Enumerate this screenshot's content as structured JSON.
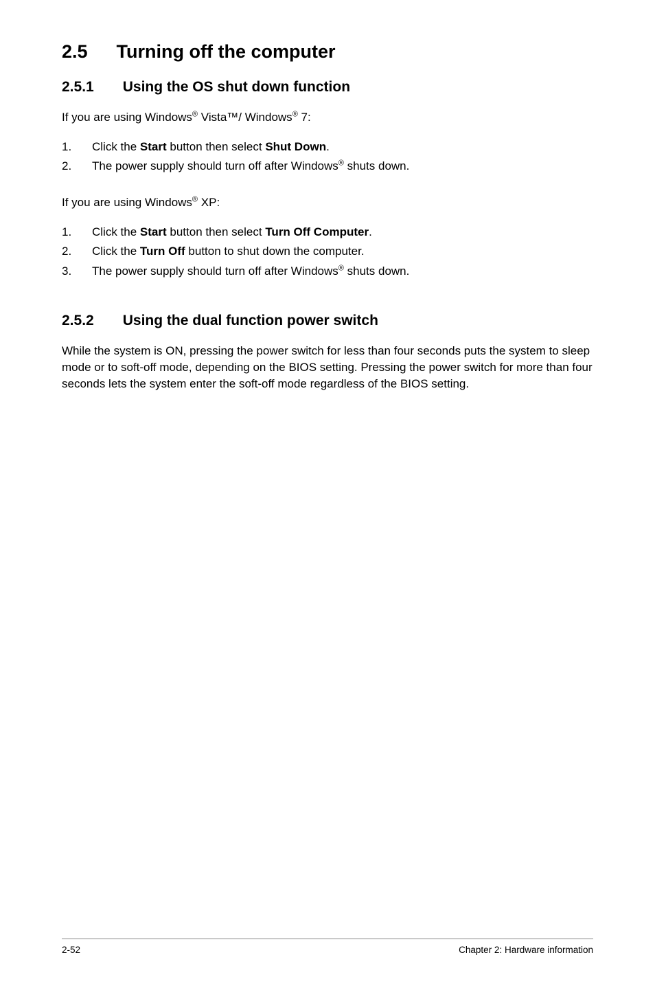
{
  "section": {
    "number": "2.5",
    "title": "Turning off the computer"
  },
  "subsection1": {
    "number": "2.5.1",
    "title": "Using the OS shut down function",
    "intro1_prefix": "If you are using Windows",
    "intro1_mid": " Vista™/ Windows",
    "intro1_suffix": " 7:",
    "list1": [
      {
        "num": "1.",
        "pre": "Click the ",
        "bold1": "Start",
        "mid": " button then select ",
        "bold2": "Shut Down",
        "post": "."
      },
      {
        "num": "2.",
        "pre": "The power supply should turn off after Windows",
        "sup": "®",
        "post": " shuts down."
      }
    ],
    "intro2_prefix": "If you are using Windows",
    "intro2_suffix": " XP:",
    "list2": [
      {
        "num": "1.",
        "pre": "Click the ",
        "bold1": "Start",
        "mid": " button then select ",
        "bold2": "Turn Off Computer",
        "post": "."
      },
      {
        "num": "2.",
        "pre": "Click the ",
        "bold1": "Turn Off",
        "post": " button to shut down the computer."
      },
      {
        "num": "3.",
        "pre": "The power supply should turn off after Windows",
        "sup": "®",
        "post": " shuts down."
      }
    ]
  },
  "subsection2": {
    "number": "2.5.2",
    "title": "Using the dual function power switch",
    "body": "While the system is ON, pressing the power switch for less than four seconds puts the system to sleep mode or to soft-off mode, depending on the BIOS setting. Pressing the power switch for more than four seconds lets the system enter the soft-off mode regardless of the BIOS setting."
  },
  "footer": {
    "page": "2-52",
    "chapter": "Chapter 2: Hardware information"
  },
  "reg": "®"
}
